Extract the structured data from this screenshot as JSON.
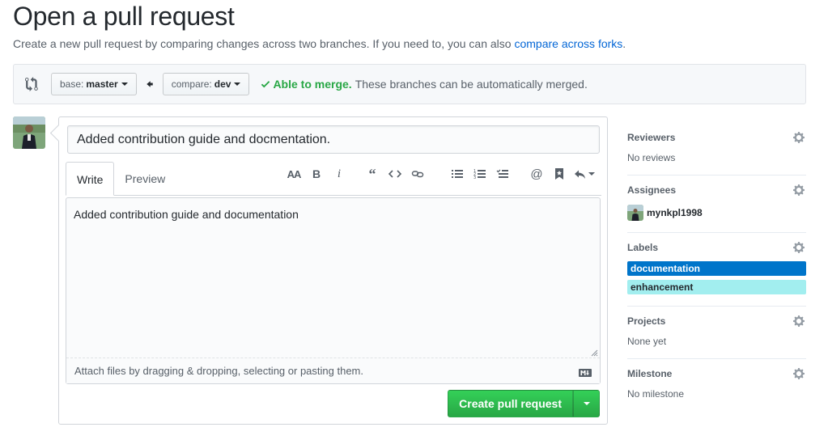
{
  "page": {
    "title": "Open a pull request",
    "subtitle": "Create a new pull request by comparing changes across two branches. If you need to, you can also ",
    "subtitle_link": "compare across forks",
    "subtitle_end": "."
  },
  "range": {
    "base_label": "base:",
    "base_value": "master",
    "compare_label": "compare:",
    "compare_value": "dev",
    "merge_ok": "Able to merge.",
    "merge_text": "These branches can be automatically merged."
  },
  "composer": {
    "title_value": "Added contribution guide and docmentation.",
    "tabs": [
      {
        "label": "Write",
        "active": true
      },
      {
        "label": "Preview",
        "active": false
      }
    ],
    "toolbar_icons": [
      "header-icon",
      "bold-icon",
      "italic-icon",
      "quote-icon",
      "code-icon",
      "link-icon",
      "unordered-list-icon",
      "ordered-list-icon",
      "task-list-icon",
      "mention-icon",
      "saved-reply-icon",
      "reply-icon"
    ],
    "body_value": "Added contribution guide and documentation",
    "attach_text": "Attach files by dragging & dropping, selecting or pasting them.",
    "submit_label": "Create pull request"
  },
  "sidebar": {
    "reviewers": {
      "heading": "Reviewers",
      "value": "No reviews"
    },
    "assignees": {
      "heading": "Assignees",
      "user": "mynkpl1998"
    },
    "labels": {
      "heading": "Labels",
      "items": [
        {
          "name": "documentation",
          "bg": "#0075ca",
          "fg": "#ffffff"
        },
        {
          "name": "enhancement",
          "bg": "#a2eeef",
          "fg": "#24292e"
        }
      ]
    },
    "projects": {
      "heading": "Projects",
      "value": "None yet"
    },
    "milestone": {
      "heading": "Milestone",
      "value": "No milestone"
    }
  },
  "colors": {
    "accent_link": "#0366d6",
    "success": "#28a745",
    "border": "#d1d5da"
  }
}
